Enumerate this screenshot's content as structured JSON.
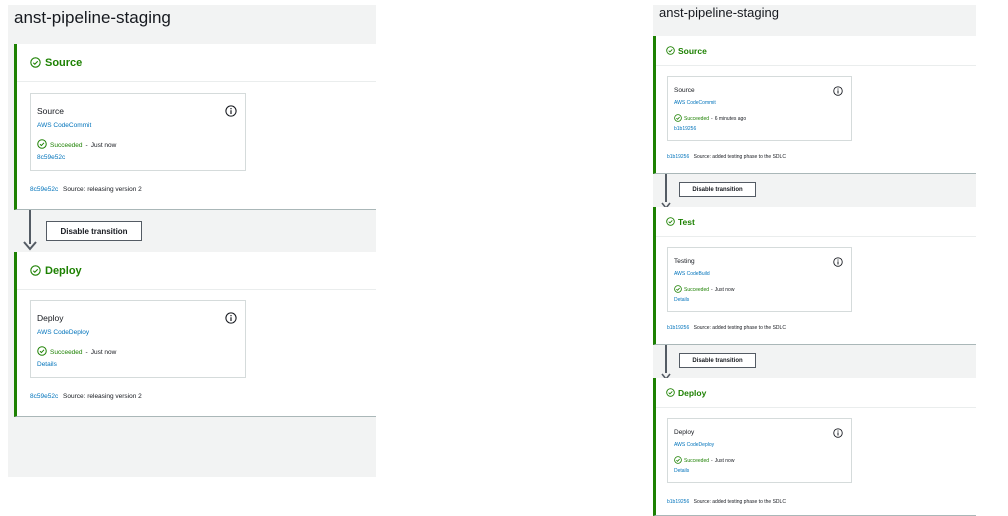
{
  "left": {
    "title": "anst-pipeline-staging",
    "stages": [
      {
        "name": "Source",
        "action": {
          "name": "Source",
          "provider": "AWS CodeCommit",
          "status": "Succeeded",
          "sep": "-",
          "time": "Just now",
          "link": "8c59e52c"
        },
        "footer": {
          "commit": "8c59e52c",
          "message": "Source: releasing version 2"
        }
      },
      {
        "name": "Deploy",
        "action": {
          "name": "Deploy",
          "provider": "AWS CodeDeploy",
          "status": "Succeeded",
          "sep": "-",
          "time": "Just now",
          "link": "Details"
        },
        "footer": {
          "commit": "8c59e52c",
          "message": "Source: releasing version 2"
        }
      }
    ],
    "transitions": [
      {
        "label": "Disable transition"
      }
    ]
  },
  "right": {
    "title": "anst-pipeline-staging",
    "stages": [
      {
        "name": "Source",
        "action": {
          "name": "Source",
          "provider": "AWS CodeCommit",
          "status": "Succeeded",
          "sep": "-",
          "time": "6 minutes ago",
          "link": "b1b19256"
        },
        "footer": {
          "commit": "b1b19256",
          "message": "Source: added testing phase to the SDLC"
        }
      },
      {
        "name": "Test",
        "action": {
          "name": "Testing",
          "provider": "AWS CodeBuild",
          "status": "Succeeded",
          "sep": "-",
          "time": "Just now",
          "link": "Details"
        },
        "footer": {
          "commit": "b1b19256",
          "message": "Source: added testing phase to the SDLC"
        }
      },
      {
        "name": "Deploy",
        "action": {
          "name": "Deploy",
          "provider": "AWS CodeDeploy",
          "status": "Succeeded",
          "sep": "-",
          "time": "Just now",
          "link": "Details"
        },
        "footer": {
          "commit": "b1b19256",
          "message": "Source: added testing phase to the SDLC"
        }
      }
    ],
    "transitions": [
      {
        "label": "Disable transition"
      },
      {
        "label": "Disable transition"
      }
    ]
  },
  "colors": {
    "success": "#1d8102",
    "link": "#0073bb",
    "background": "#f2f3f3"
  },
  "icons": {
    "status": "check-circle-icon",
    "info": "info-icon",
    "transition": "arrow-down-icon"
  }
}
